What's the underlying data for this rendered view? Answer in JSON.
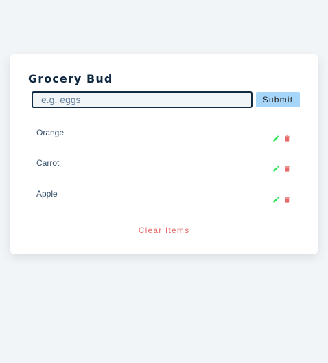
{
  "app": {
    "title": "Grocery Bud"
  },
  "form": {
    "placeholder": "e.g. eggs",
    "value": "",
    "submit_label": "Submit"
  },
  "items": [
    {
      "name": "Orange"
    },
    {
      "name": "Carrot"
    },
    {
      "name": "Apple"
    }
  ],
  "icons": {
    "edit": "edit-icon",
    "delete": "trash-icon"
  },
  "colors": {
    "background": "#f1f5f8",
    "edit": "#2fe35a",
    "delete": "#e66b6b",
    "submit_bg": "#a5d5f8",
    "title": "#102a42"
  },
  "footer": {
    "clear_label": "Clear Items"
  }
}
